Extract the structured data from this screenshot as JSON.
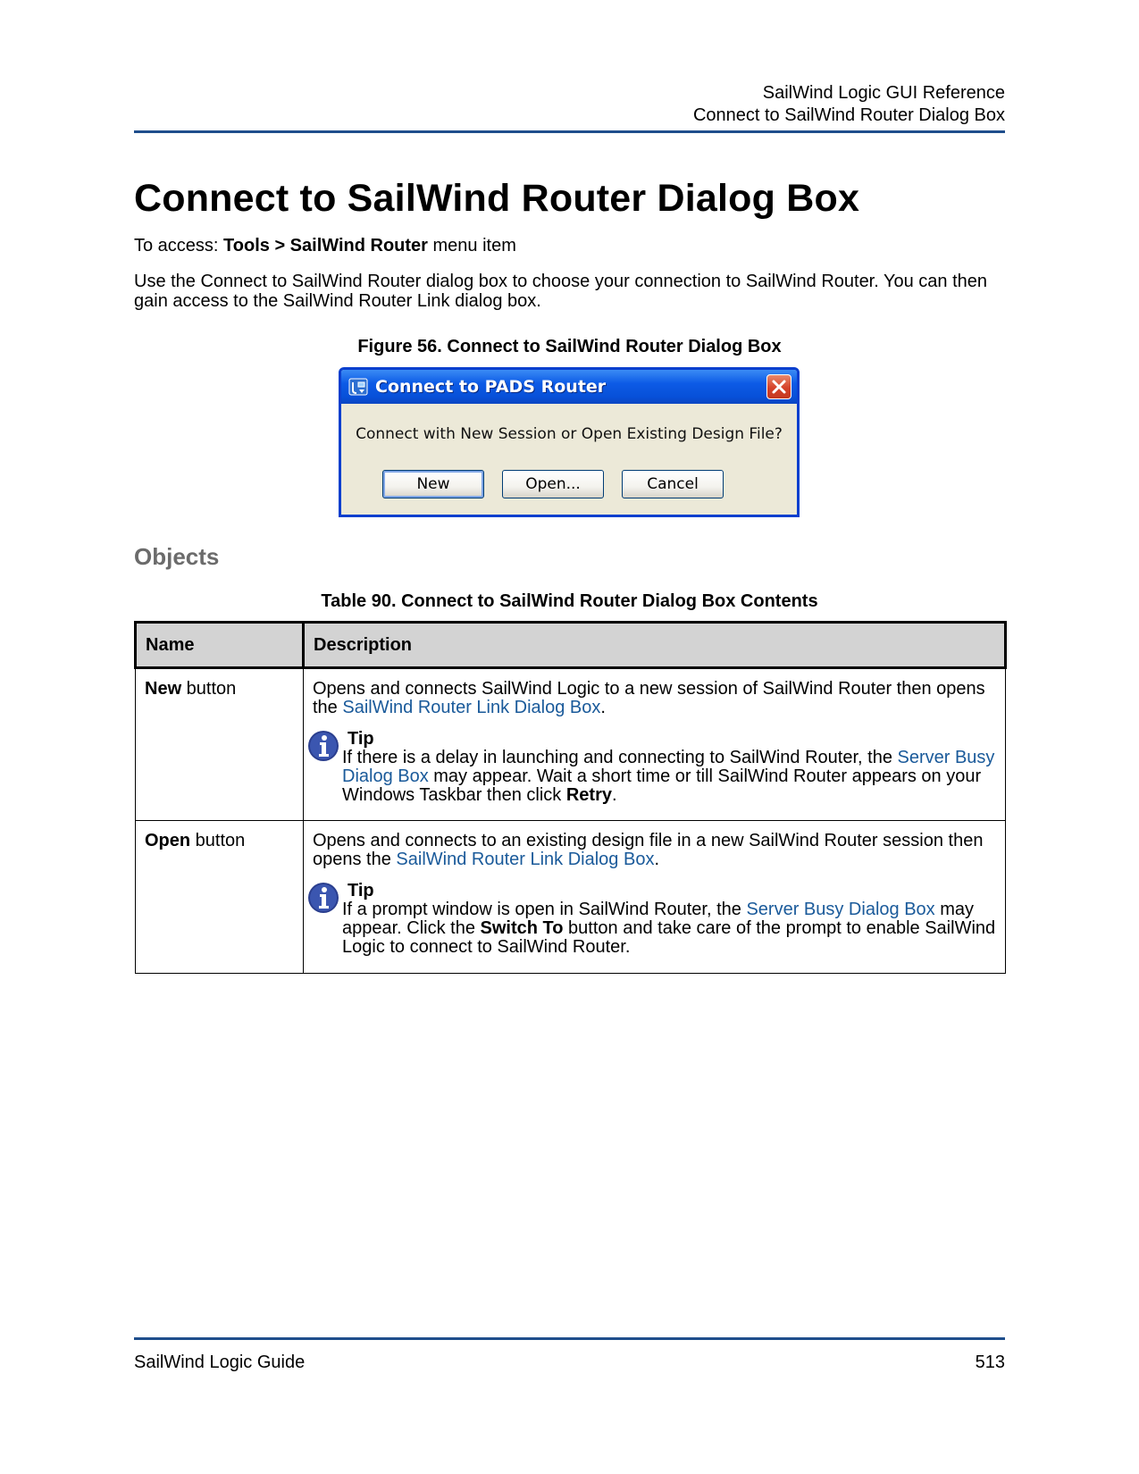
{
  "header": {
    "line1": "SailWind Logic GUI Reference",
    "line2": "Connect to SailWind Router Dialog Box"
  },
  "title": "Connect to SailWind Router Dialog Box",
  "access": {
    "prefix": "To access: ",
    "path_bold": "Tools > SailWind Router",
    "suffix": " menu item"
  },
  "intro": "Use the Connect to SailWind Router dialog box to choose your connection to SailWind Router. You can then gain access to the SailWind Router Link dialog box.",
  "figure": {
    "caption": "Figure 56. Connect to SailWind Router Dialog Box",
    "dialog": {
      "title": "Connect to PADS Router",
      "message": "Connect with New Session or Open Existing Design File?",
      "buttons": {
        "new": "New",
        "open": "Open...",
        "cancel": "Cancel"
      },
      "colors": {
        "titlebar": "#0750d8",
        "body": "#ece9d8",
        "close": "#d6422a"
      }
    }
  },
  "section": "Objects",
  "table": {
    "caption": "Table 90. Connect to SailWind Router Dialog Box Contents",
    "headers": {
      "name": "Name",
      "description": "Description"
    },
    "rows": [
      {
        "name_bold": "New",
        "name_rest": " button",
        "desc_pre": "Opens and connects SailWind Logic to a new session of SailWind Router then opens the ",
        "desc_link": "SailWind Router Link Dialog Box",
        "desc_post": ".",
        "tip_title": "Tip",
        "tip_pre": "If there is a delay in launching and connecting to SailWind Router, the ",
        "tip_link": "Server Busy Dialog Box",
        "tip_mid": " may appear. Wait a short time or till SailWind Router appears on your Windows Taskbar then click ",
        "tip_bold": "Retry",
        "tip_post": "."
      },
      {
        "name_bold": "Open",
        "name_rest": " button",
        "desc_pre": "Opens and connects to an existing design file in a new SailWind Router session then opens the ",
        "desc_link": "SailWind Router Link Dialog Box",
        "desc_post": ".",
        "tip_title": "Tip",
        "tip_pre": "If a prompt window is open in SailWind Router, the ",
        "tip_link": "Server Busy Dialog Box",
        "tip_mid": " may appear. Click the ",
        "tip_bold": "Switch To",
        "tip_post": " button and take care of the prompt to enable SailWind Logic to connect to SailWind Router."
      }
    ]
  },
  "footer": {
    "left": "SailWind Logic Guide",
    "right": "513"
  },
  "colors": {
    "rule": "#1f4e8c",
    "link": "#1a5a9a",
    "heading2": "#6b6b6b",
    "table_header": "#d3d3d3"
  }
}
